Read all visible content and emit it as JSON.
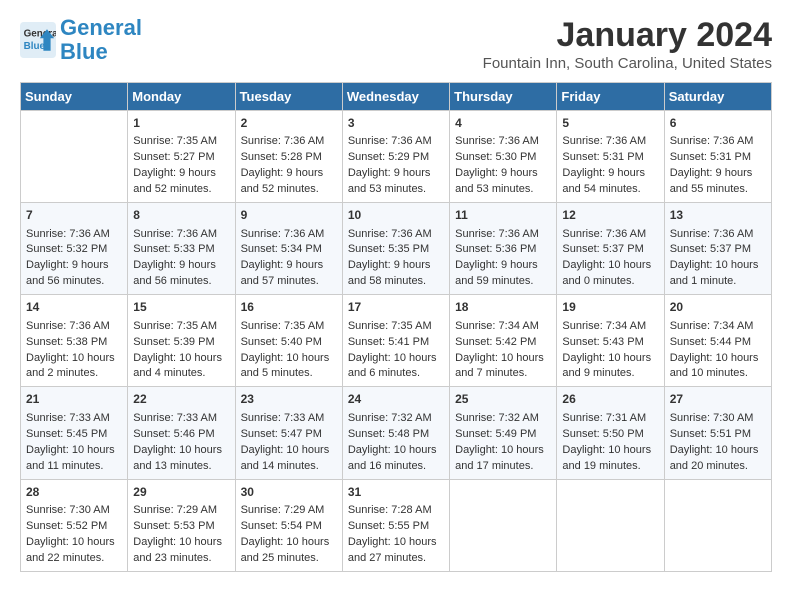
{
  "header": {
    "logo_line1": "General",
    "logo_line2": "Blue",
    "month": "January 2024",
    "location": "Fountain Inn, South Carolina, United States"
  },
  "columns": [
    "Sunday",
    "Monday",
    "Tuesday",
    "Wednesday",
    "Thursday",
    "Friday",
    "Saturday"
  ],
  "weeks": [
    [
      {
        "day": "",
        "data": ""
      },
      {
        "day": "1",
        "data": "Sunrise: 7:35 AM\nSunset: 5:27 PM\nDaylight: 9 hours\nand 52 minutes."
      },
      {
        "day": "2",
        "data": "Sunrise: 7:36 AM\nSunset: 5:28 PM\nDaylight: 9 hours\nand 52 minutes."
      },
      {
        "day": "3",
        "data": "Sunrise: 7:36 AM\nSunset: 5:29 PM\nDaylight: 9 hours\nand 53 minutes."
      },
      {
        "day": "4",
        "data": "Sunrise: 7:36 AM\nSunset: 5:30 PM\nDaylight: 9 hours\nand 53 minutes."
      },
      {
        "day": "5",
        "data": "Sunrise: 7:36 AM\nSunset: 5:31 PM\nDaylight: 9 hours\nand 54 minutes."
      },
      {
        "day": "6",
        "data": "Sunrise: 7:36 AM\nSunset: 5:31 PM\nDaylight: 9 hours\nand 55 minutes."
      }
    ],
    [
      {
        "day": "7",
        "data": "Sunrise: 7:36 AM\nSunset: 5:32 PM\nDaylight: 9 hours\nand 56 minutes."
      },
      {
        "day": "8",
        "data": "Sunrise: 7:36 AM\nSunset: 5:33 PM\nDaylight: 9 hours\nand 56 minutes."
      },
      {
        "day": "9",
        "data": "Sunrise: 7:36 AM\nSunset: 5:34 PM\nDaylight: 9 hours\nand 57 minutes."
      },
      {
        "day": "10",
        "data": "Sunrise: 7:36 AM\nSunset: 5:35 PM\nDaylight: 9 hours\nand 58 minutes."
      },
      {
        "day": "11",
        "data": "Sunrise: 7:36 AM\nSunset: 5:36 PM\nDaylight: 9 hours\nand 59 minutes."
      },
      {
        "day": "12",
        "data": "Sunrise: 7:36 AM\nSunset: 5:37 PM\nDaylight: 10 hours\nand 0 minutes."
      },
      {
        "day": "13",
        "data": "Sunrise: 7:36 AM\nSunset: 5:37 PM\nDaylight: 10 hours\nand 1 minute."
      }
    ],
    [
      {
        "day": "14",
        "data": "Sunrise: 7:36 AM\nSunset: 5:38 PM\nDaylight: 10 hours\nand 2 minutes."
      },
      {
        "day": "15",
        "data": "Sunrise: 7:35 AM\nSunset: 5:39 PM\nDaylight: 10 hours\nand 4 minutes."
      },
      {
        "day": "16",
        "data": "Sunrise: 7:35 AM\nSunset: 5:40 PM\nDaylight: 10 hours\nand 5 minutes."
      },
      {
        "day": "17",
        "data": "Sunrise: 7:35 AM\nSunset: 5:41 PM\nDaylight: 10 hours\nand 6 minutes."
      },
      {
        "day": "18",
        "data": "Sunrise: 7:34 AM\nSunset: 5:42 PM\nDaylight: 10 hours\nand 7 minutes."
      },
      {
        "day": "19",
        "data": "Sunrise: 7:34 AM\nSunset: 5:43 PM\nDaylight: 10 hours\nand 9 minutes."
      },
      {
        "day": "20",
        "data": "Sunrise: 7:34 AM\nSunset: 5:44 PM\nDaylight: 10 hours\nand 10 minutes."
      }
    ],
    [
      {
        "day": "21",
        "data": "Sunrise: 7:33 AM\nSunset: 5:45 PM\nDaylight: 10 hours\nand 11 minutes."
      },
      {
        "day": "22",
        "data": "Sunrise: 7:33 AM\nSunset: 5:46 PM\nDaylight: 10 hours\nand 13 minutes."
      },
      {
        "day": "23",
        "data": "Sunrise: 7:33 AM\nSunset: 5:47 PM\nDaylight: 10 hours\nand 14 minutes."
      },
      {
        "day": "24",
        "data": "Sunrise: 7:32 AM\nSunset: 5:48 PM\nDaylight: 10 hours\nand 16 minutes."
      },
      {
        "day": "25",
        "data": "Sunrise: 7:32 AM\nSunset: 5:49 PM\nDaylight: 10 hours\nand 17 minutes."
      },
      {
        "day": "26",
        "data": "Sunrise: 7:31 AM\nSunset: 5:50 PM\nDaylight: 10 hours\nand 19 minutes."
      },
      {
        "day": "27",
        "data": "Sunrise: 7:30 AM\nSunset: 5:51 PM\nDaylight: 10 hours\nand 20 minutes."
      }
    ],
    [
      {
        "day": "28",
        "data": "Sunrise: 7:30 AM\nSunset: 5:52 PM\nDaylight: 10 hours\nand 22 minutes."
      },
      {
        "day": "29",
        "data": "Sunrise: 7:29 AM\nSunset: 5:53 PM\nDaylight: 10 hours\nand 23 minutes."
      },
      {
        "day": "30",
        "data": "Sunrise: 7:29 AM\nSunset: 5:54 PM\nDaylight: 10 hours\nand 25 minutes."
      },
      {
        "day": "31",
        "data": "Sunrise: 7:28 AM\nSunset: 5:55 PM\nDaylight: 10 hours\nand 27 minutes."
      },
      {
        "day": "",
        "data": ""
      },
      {
        "day": "",
        "data": ""
      },
      {
        "day": "",
        "data": ""
      }
    ]
  ]
}
